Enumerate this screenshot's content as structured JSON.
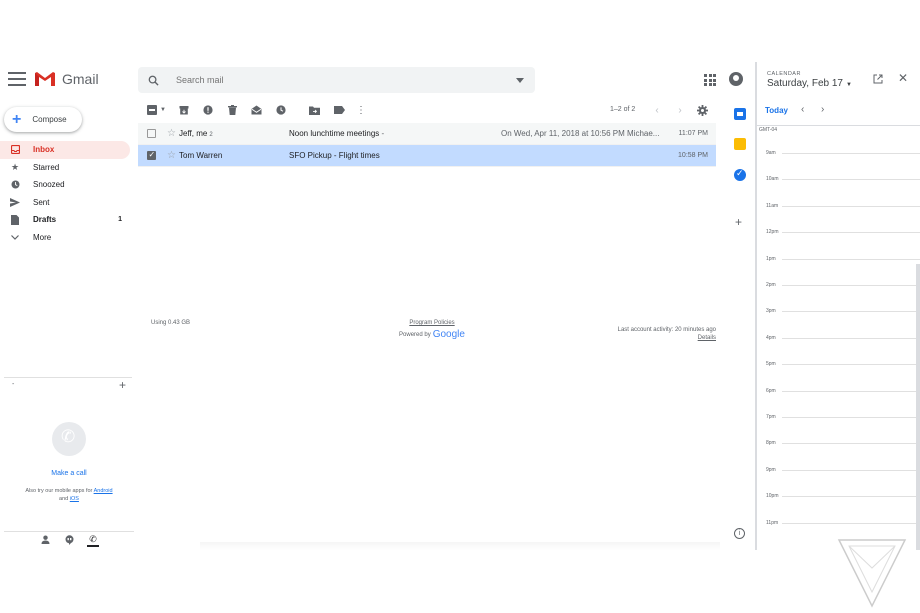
{
  "header": {
    "app_name": "Gmail",
    "search_placeholder": "Search mail"
  },
  "sidebar": {
    "compose_label": "Compose",
    "items": [
      {
        "label": "Inbox",
        "count": ""
      },
      {
        "label": "Starred",
        "count": ""
      },
      {
        "label": "Snoozed",
        "count": ""
      },
      {
        "label": "Sent",
        "count": ""
      },
      {
        "label": "Drafts",
        "count": "1"
      },
      {
        "label": "More",
        "count": ""
      }
    ],
    "hangouts_collapsed": "-",
    "make_call": "Make a call",
    "also_try": "Also try our mobile apps for",
    "android": "Android",
    "and": "and",
    "ios": "iOS"
  },
  "toolbar": {
    "pager": "1–2 of 2"
  },
  "emails": [
    {
      "sender": "Jeff, me",
      "count": "2",
      "subject": "Noon lunchtime meetings",
      "separator": " -",
      "snippet": "On Wed, Apr 11, 2018 at 10:56 PM Michae...",
      "time": "11:07 PM"
    },
    {
      "sender": "Tom Warren",
      "count": "",
      "subject": "SFO Pickup",
      "separator": " - Flight times",
      "snippet": "",
      "time": "10:58 PM"
    }
  ],
  "footer": {
    "storage": "Using 0.43 GB",
    "policies": "Program Policies",
    "powered_by": "Powered by",
    "google": "Google",
    "activity": "Last account activity: 20 minutes ago",
    "details": "Details"
  },
  "calendar": {
    "label": "CALENDAR",
    "date": "Saturday, Feb 17",
    "today": "Today",
    "timezone": "GMT-04",
    "hours": [
      "9am",
      "10am",
      "11am",
      "12pm",
      "1pm",
      "2pm",
      "3pm",
      "4pm",
      "5pm",
      "6pm",
      "7pm",
      "8pm",
      "9pm",
      "10pm",
      "11pm"
    ]
  },
  "colors": {
    "accent": "#1a73e8",
    "inbox_active": "#d93025",
    "selected_row": "#c2dbff"
  }
}
